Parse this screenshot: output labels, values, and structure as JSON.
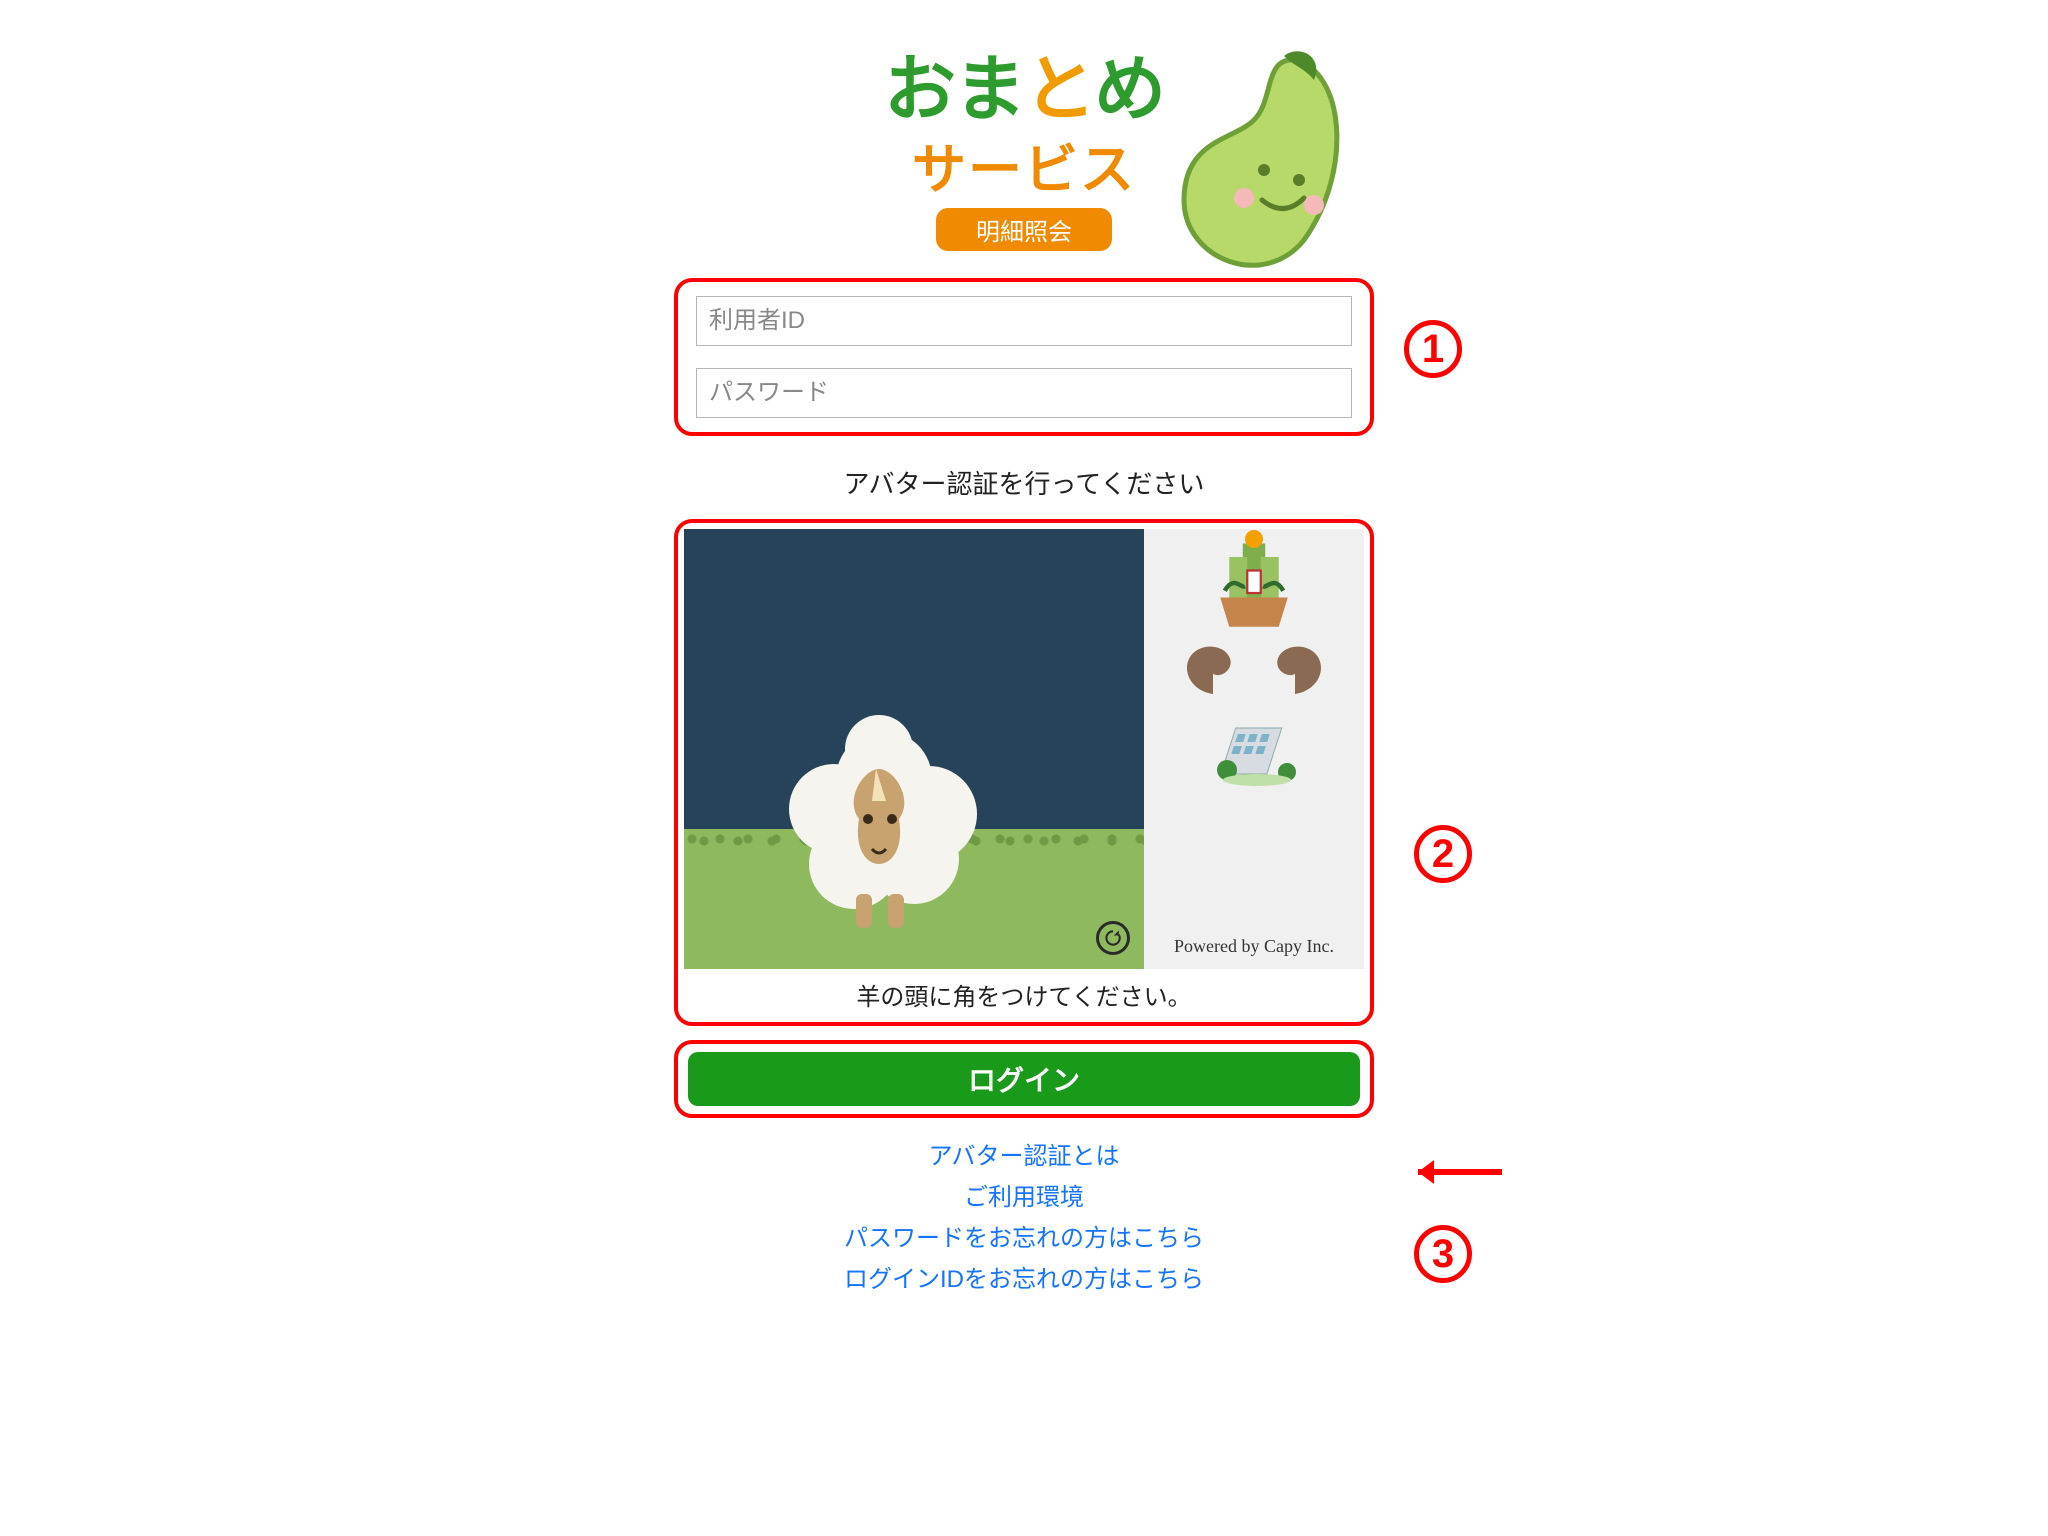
{
  "logo": {
    "line1_chars": {
      "a": "お",
      "b": "ま",
      "c": "と",
      "d": "め"
    },
    "line2": "サービス",
    "chip": "明細照会"
  },
  "inputs": {
    "user_id_placeholder": "利用者ID",
    "password_placeholder": "パスワード"
  },
  "avatar_prompt": "アバター認証を行ってください",
  "captcha": {
    "instruction": "羊の頭に角をつけてください。",
    "credit": "Powered by Capy Inc.",
    "piece_names": [
      "kadomatsu-icon",
      "horn-left-icon",
      "horn-right-icon",
      "building-icon"
    ]
  },
  "login_label": "ログイン",
  "links": {
    "about_avatar": "アバター認証とは",
    "environment": "ご利用環境",
    "forgot_password": "パスワードをお忘れの方はこちら",
    "forgot_login_id": "ログインIDをお忘れの方はこちら"
  },
  "annotations": {
    "n1": "1",
    "n2": "2",
    "n3": "3"
  },
  "colors": {
    "highlight": "#ff0000",
    "primary_green": "#1a9a1a",
    "link_blue": "#1474ff",
    "logo_green": "#2e9b2e",
    "logo_orange": "#f08a00"
  }
}
